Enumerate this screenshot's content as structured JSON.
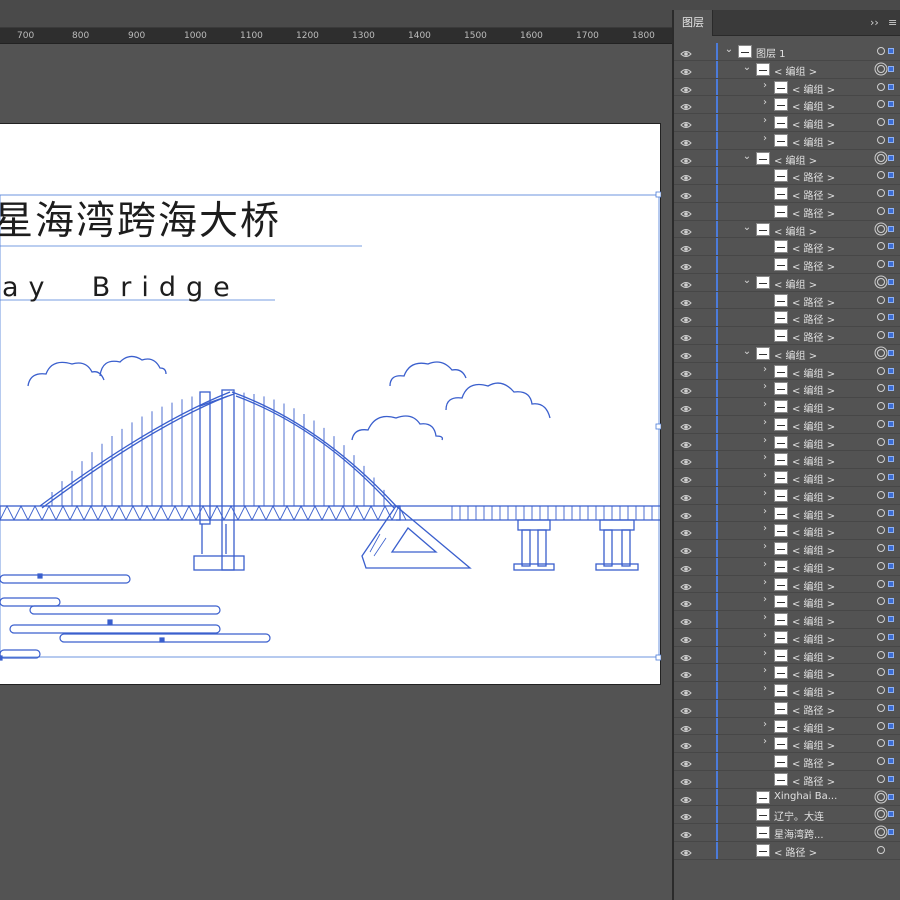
{
  "ruler": {
    "ticks": [
      "700",
      "800",
      "900",
      "1000",
      "1100",
      "1200",
      "1300",
      "1400",
      "1500",
      "1600",
      "1700",
      "1800"
    ]
  },
  "artwork": {
    "title_cn": "星海湾跨海大桥",
    "subtitle_en": "ay  Bridge",
    "line_color": "#3a5fcd"
  },
  "layers_panel": {
    "tab_label": "图层",
    "collapse_label": "››",
    "menu_label": "≡",
    "rows": [
      {
        "label": "图层 1",
        "indent": 0,
        "chevron": "v",
        "thumb": true,
        "dbl": false,
        "sel": true
      },
      {
        "label": "< 编组 >",
        "indent": 1,
        "chevron": "v",
        "thumb": true,
        "dbl": true,
        "sel": true
      },
      {
        "label": "< 编组 >",
        "indent": 2,
        "chevron": ">",
        "thumb": true,
        "dbl": false,
        "sel": true
      },
      {
        "label": "< 编组 >",
        "indent": 2,
        "chevron": ">",
        "thumb": true,
        "dbl": false,
        "sel": true
      },
      {
        "label": "< 编组 >",
        "indent": 2,
        "chevron": ">",
        "thumb": true,
        "dbl": false,
        "sel": true
      },
      {
        "label": "< 编组 >",
        "indent": 2,
        "chevron": ">",
        "thumb": true,
        "dbl": false,
        "sel": true
      },
      {
        "label": "< 编组 >",
        "indent": 1,
        "chevron": "v",
        "thumb": true,
        "dbl": true,
        "sel": true
      },
      {
        "label": "< 路径 >",
        "indent": 2,
        "chevron": "",
        "thumb": true,
        "dbl": false,
        "sel": true
      },
      {
        "label": "< 路径 >",
        "indent": 2,
        "chevron": "",
        "thumb": true,
        "dbl": false,
        "sel": true
      },
      {
        "label": "< 路径 >",
        "indent": 2,
        "chevron": "",
        "thumb": true,
        "dbl": false,
        "sel": true
      },
      {
        "label": "< 编组 >",
        "indent": 1,
        "chevron": "v",
        "thumb": true,
        "dbl": true,
        "sel": true
      },
      {
        "label": "< 路径 >",
        "indent": 2,
        "chevron": "",
        "thumb": true,
        "dbl": false,
        "sel": true
      },
      {
        "label": "< 路径 >",
        "indent": 2,
        "chevron": "",
        "thumb": true,
        "dbl": false,
        "sel": true
      },
      {
        "label": "< 编组 >",
        "indent": 1,
        "chevron": "v",
        "thumb": true,
        "dbl": true,
        "sel": true
      },
      {
        "label": "< 路径 >",
        "indent": 2,
        "chevron": "",
        "thumb": true,
        "dbl": false,
        "sel": true
      },
      {
        "label": "< 路径 >",
        "indent": 2,
        "chevron": "",
        "thumb": true,
        "dbl": false,
        "sel": true
      },
      {
        "label": "< 路径 >",
        "indent": 2,
        "chevron": "",
        "thumb": true,
        "dbl": false,
        "sel": true
      },
      {
        "label": "< 编组 >",
        "indent": 1,
        "chevron": "v",
        "thumb": true,
        "dbl": true,
        "sel": true
      },
      {
        "label": "< 编组 >",
        "indent": 2,
        "chevron": ">",
        "thumb": true,
        "dbl": false,
        "sel": true
      },
      {
        "label": "< 编组 >",
        "indent": 2,
        "chevron": ">",
        "thumb": true,
        "dbl": false,
        "sel": true
      },
      {
        "label": "< 编组 >",
        "indent": 2,
        "chevron": ">",
        "thumb": true,
        "dbl": false,
        "sel": true
      },
      {
        "label": "< 编组 >",
        "indent": 2,
        "chevron": ">",
        "thumb": true,
        "dbl": false,
        "sel": true
      },
      {
        "label": "< 编组 >",
        "indent": 2,
        "chevron": ">",
        "thumb": true,
        "dbl": false,
        "sel": true
      },
      {
        "label": "< 编组 >",
        "indent": 2,
        "chevron": ">",
        "thumb": true,
        "dbl": false,
        "sel": true
      },
      {
        "label": "< 编组 >",
        "indent": 2,
        "chevron": ">",
        "thumb": true,
        "dbl": false,
        "sel": true
      },
      {
        "label": "< 编组 >",
        "indent": 2,
        "chevron": ">",
        "thumb": true,
        "dbl": false,
        "sel": true
      },
      {
        "label": "< 编组 >",
        "indent": 2,
        "chevron": ">",
        "thumb": true,
        "dbl": false,
        "sel": true
      },
      {
        "label": "< 编组 >",
        "indent": 2,
        "chevron": ">",
        "thumb": true,
        "dbl": false,
        "sel": true
      },
      {
        "label": "< 编组 >",
        "indent": 2,
        "chevron": ">",
        "thumb": true,
        "dbl": false,
        "sel": true
      },
      {
        "label": "< 编组 >",
        "indent": 2,
        "chevron": ">",
        "thumb": true,
        "dbl": false,
        "sel": true
      },
      {
        "label": "< 编组 >",
        "indent": 2,
        "chevron": ">",
        "thumb": true,
        "dbl": false,
        "sel": true
      },
      {
        "label": "< 编组 >",
        "indent": 2,
        "chevron": ">",
        "thumb": true,
        "dbl": false,
        "sel": true
      },
      {
        "label": "< 编组 >",
        "indent": 2,
        "chevron": ">",
        "thumb": true,
        "dbl": false,
        "sel": true
      },
      {
        "label": "< 编组 >",
        "indent": 2,
        "chevron": ">",
        "thumb": true,
        "dbl": false,
        "sel": true
      },
      {
        "label": "< 编组 >",
        "indent": 2,
        "chevron": ">",
        "thumb": true,
        "dbl": false,
        "sel": true
      },
      {
        "label": "< 编组 >",
        "indent": 2,
        "chevron": ">",
        "thumb": true,
        "dbl": false,
        "sel": true
      },
      {
        "label": "< 编组 >",
        "indent": 2,
        "chevron": ">",
        "thumb": true,
        "dbl": false,
        "sel": true
      },
      {
        "label": "< 路径 >",
        "indent": 2,
        "chevron": "",
        "thumb": true,
        "dbl": false,
        "sel": true
      },
      {
        "label": "< 编组 >",
        "indent": 2,
        "chevron": ">",
        "thumb": true,
        "dbl": false,
        "sel": true
      },
      {
        "label": "< 编组 >",
        "indent": 2,
        "chevron": ">",
        "thumb": true,
        "dbl": false,
        "sel": true
      },
      {
        "label": "< 路径 >",
        "indent": 2,
        "chevron": "",
        "thumb": true,
        "dbl": false,
        "sel": true
      },
      {
        "label": "< 路径 >",
        "indent": 2,
        "chevron": "",
        "thumb": true,
        "dbl": false,
        "sel": true
      },
      {
        "label": "Xinghai Ba...",
        "indent": 1,
        "chevron": "",
        "thumb": true,
        "dbl": true,
        "sel": true
      },
      {
        "label": "辽宁。大连",
        "indent": 1,
        "chevron": "",
        "thumb": true,
        "dbl": true,
        "sel": true
      },
      {
        "label": "星海湾跨...",
        "indent": 1,
        "chevron": "",
        "thumb": true,
        "dbl": true,
        "sel": true
      },
      {
        "label": "< 路径 >",
        "indent": 1,
        "chevron": "",
        "thumb": true,
        "dbl": false,
        "sel": false
      }
    ]
  }
}
